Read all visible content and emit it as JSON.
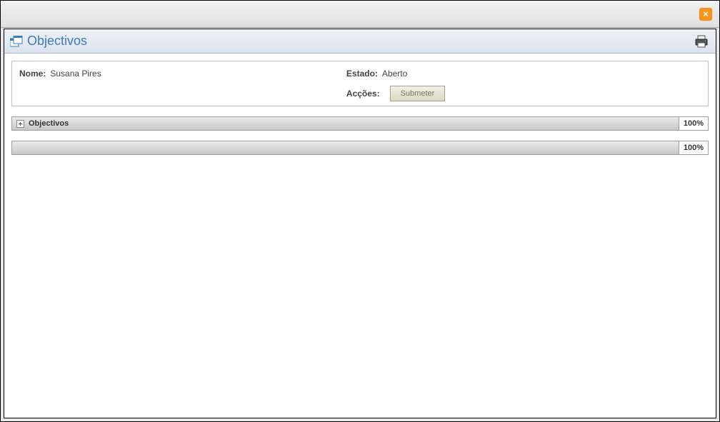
{
  "header": {
    "title": "Objectivos"
  },
  "info": {
    "name_label": "Nome:",
    "name_value": "Susana Pires",
    "status_label": "Estado:",
    "status_value": "Aberto",
    "actions_label": "Acções:",
    "submit_label": "Submeter"
  },
  "sections": [
    {
      "title": "Objectivos",
      "percent": "100%"
    },
    {
      "title": "",
      "percent": "100%"
    }
  ]
}
